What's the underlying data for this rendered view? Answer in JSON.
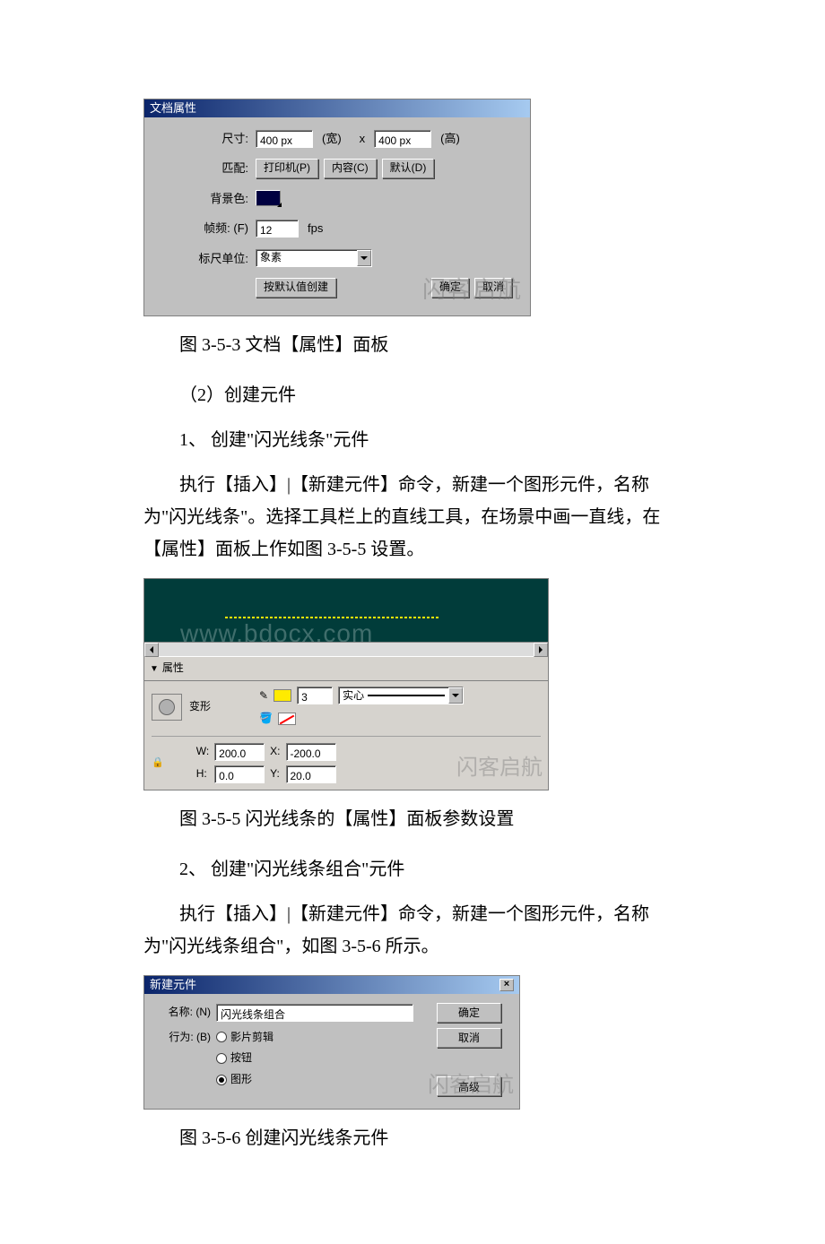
{
  "dialog1": {
    "title": "文档属性",
    "size_label": "尺寸:",
    "width": "400 px",
    "width_suffix": "(宽)",
    "x": "x",
    "height": "400 px",
    "height_suffix": "(高)",
    "match_label": "匹配:",
    "match_printer": "打印机(P)",
    "match_content": "内容(C)",
    "match_default": "默认(D)",
    "bg_label": "背景色:",
    "fps_label": "帧频: (F)",
    "fps_value": "12",
    "fps_unit": "fps",
    "ruler_label": "标尺单位:",
    "ruler_value": "象素",
    "create_default": "按默认值创建",
    "ok": "确定",
    "cancel": "取消",
    "watermark": "闪客启航"
  },
  "caption1": "图 3-5-3 文档【属性】面板",
  "text_step2": "（2）创建元件",
  "text_1": "1、 创建\"闪光线条\"元件",
  "para1": "执行【插入】|【新建元件】命令，新建一个图形元件，名称为\"闪光线条\"。选择工具栏上的直线工具，在场景中画一直线，在【属性】面板上作如图 3-5-5 设置。",
  "panel2": {
    "canvas_wm": "www.bdocx.com",
    "header": "▼ 属性",
    "shape_label": "变形",
    "stroke_thickness": "3",
    "stroke_style": "实心",
    "W_label": "W:",
    "W": "200.0",
    "X_label": "X:",
    "X": "-200.0",
    "H_label": "H:",
    "H": "0.0",
    "Y_label": "Y:",
    "Y": "20.0",
    "watermark": "闪客启航"
  },
  "caption2": "图 3-5-5 闪光线条的【属性】面板参数设置",
  "text_2": "2、 创建\"闪光线条组合\"元件",
  "para2": "执行【插入】|【新建元件】命令，新建一个图形元件，名称为\"闪光线条组合\"，如图 3-5-6 所示。",
  "dialog3": {
    "title": "新建元件",
    "name_label": "名称: (N)",
    "name_value": "闪光线条组合",
    "behavior_label": "行为: (B)",
    "opt_movie": "影片剪辑",
    "opt_button": "按钮",
    "opt_graphic": "图形",
    "ok": "确定",
    "cancel": "取消",
    "advanced": "高级",
    "watermark": "闪客启航"
  },
  "caption3": "图 3-5-6 创建闪光线条元件"
}
